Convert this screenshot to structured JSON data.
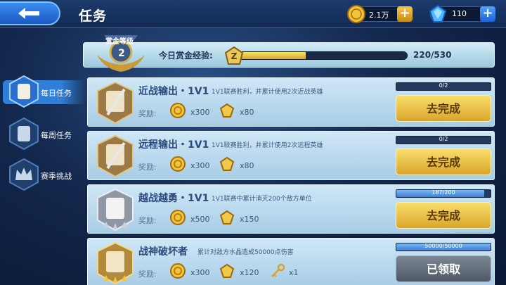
{
  "header": {
    "title": "任务",
    "coins": "2.1万",
    "gems": "110"
  },
  "bounty": {
    "level_label": "赏金等级",
    "level": "2",
    "xp_label": "今日赏金经验:",
    "xp_text": "220/530",
    "xp_progress": 0.415
  },
  "tabs": [
    {
      "label": "每日任务",
      "active": true
    },
    {
      "label": "每周任务",
      "active": false
    },
    {
      "label": "赛季挑战",
      "active": false
    }
  ],
  "reward_label": "奖励:",
  "quests": [
    {
      "name": "近战输出・1V1",
      "desc": "1V1联赛胜利，并累计使用2次近战英雄",
      "coins": "x300",
      "gems": "x80",
      "progress_text": "0/2",
      "progress": 0,
      "button": "去完成",
      "state": "go"
    },
    {
      "name": "远程输出・1V1",
      "desc": "1V1联赛胜利，并累计使用2次远程英雄",
      "coins": "x300",
      "gems": "x80",
      "progress_text": "0/2",
      "progress": 0,
      "button": "去完成",
      "state": "go"
    },
    {
      "name": "越战越勇・1V1",
      "desc": "1V1联赛中累计消灭200个敌方单位",
      "coins": "x500",
      "gems": "x150",
      "progress_text": "187/200",
      "progress": 0.935,
      "button": "去完成",
      "state": "go"
    },
    {
      "name": "战神破坏者",
      "desc": "累计对敌方水晶造成50000点伤害",
      "coins": "x300",
      "gems": "x120",
      "key": "x1",
      "progress_text": "50000/50000",
      "progress": 1,
      "button": "已领取",
      "state": "claimed"
    }
  ],
  "icons": {
    "back": "back-arrow-icon",
    "coin": "gold-coin-icon",
    "gem": "blue-gem-icon",
    "plus": "plus-icon",
    "key": "golden-key-icon"
  },
  "colors": {
    "accent_gold": "#e8b93a",
    "accent_blue": "#2f7fd9"
  }
}
